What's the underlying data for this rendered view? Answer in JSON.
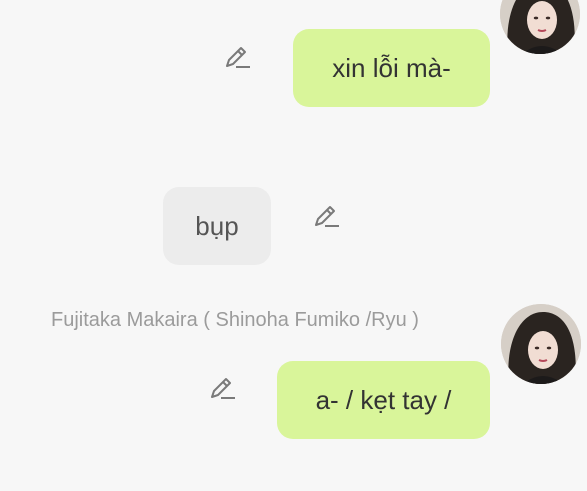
{
  "messages": [
    {
      "sender_name": "",
      "text": "xin lỗi mà-",
      "side": "right",
      "bubble_color": "#d9f59a"
    },
    {
      "sender_name": "",
      "text": "bụp",
      "side": "left",
      "bubble_color": "#ececec"
    },
    {
      "sender_name": "Fujitaka Makaira ( Shinoha Fumiko /Ryu )",
      "text": "a- / kẹt tay /",
      "side": "right",
      "bubble_color": "#d9f59a"
    }
  ],
  "icons": {
    "edit": "pencil-edit-icon"
  },
  "colors": {
    "background": "#f7f7f7",
    "sender_name": "#9b9b9b"
  }
}
